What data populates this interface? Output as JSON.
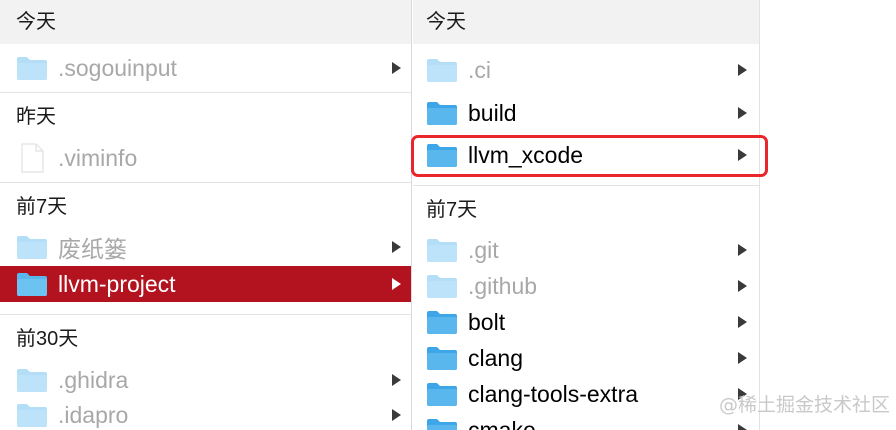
{
  "column1": {
    "groups": [
      {
        "header": "今天",
        "items": [
          {
            "name": ".sogouinput",
            "icon": "folder-icon",
            "dim": true,
            "has_children": true
          }
        ]
      },
      {
        "header": "昨天",
        "items": [
          {
            "name": ".viminfo",
            "icon": "file-icon",
            "dim": true,
            "has_children": false
          }
        ]
      },
      {
        "header": "前7天",
        "items": [
          {
            "name": "废纸篓",
            "icon": "folder-icon",
            "dim": true,
            "has_children": true
          },
          {
            "name": "llvm-project",
            "icon": "folder-icon",
            "dim": false,
            "selected": true,
            "has_children": true
          }
        ]
      },
      {
        "header": "前30天",
        "items": [
          {
            "name": ".ghidra",
            "icon": "folder-icon",
            "dim": true,
            "has_children": true
          },
          {
            "name": ".idapro",
            "icon": "folder-icon",
            "dim": true,
            "has_children": true
          }
        ]
      }
    ]
  },
  "column2": {
    "groups": [
      {
        "header": "今天",
        "items": [
          {
            "name": ".ci",
            "icon": "folder-icon",
            "dim": true,
            "has_children": true
          },
          {
            "name": "build",
            "icon": "folder-icon",
            "dim": false,
            "has_children": true
          },
          {
            "name": "llvm_xcode",
            "icon": "folder-icon",
            "dim": false,
            "highlighted": true,
            "has_children": true
          }
        ]
      },
      {
        "header": "前7天",
        "items": [
          {
            "name": ".git",
            "icon": "folder-icon",
            "dim": true,
            "has_children": true
          },
          {
            "name": ".github",
            "icon": "folder-icon",
            "dim": true,
            "has_children": true
          },
          {
            "name": "bolt",
            "icon": "folder-icon",
            "dim": false,
            "has_children": true
          },
          {
            "name": "clang",
            "icon": "folder-icon",
            "dim": false,
            "has_children": true
          },
          {
            "name": "clang-tools-extra",
            "icon": "folder-icon",
            "dim": false,
            "has_children": true
          },
          {
            "name": "cmake",
            "icon": "folder-icon",
            "dim": false,
            "has_children": true
          }
        ]
      }
    ]
  },
  "colors": {
    "selection": "#b3121f",
    "highlight_border": "#e8262c",
    "folder_blue": "#5ab7ee"
  },
  "watermark": "@稀土掘金技术社区"
}
